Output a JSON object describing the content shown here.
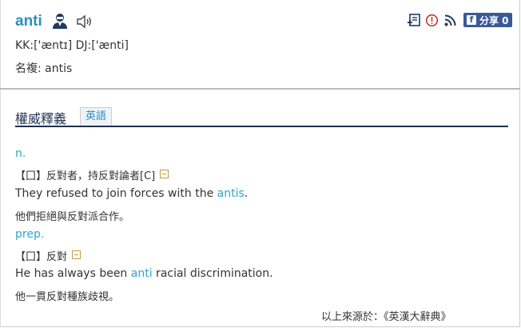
{
  "entry": {
    "word": "anti",
    "kk": "KK:['æntɪ] DJ:['ænti]",
    "plural": "名複: antis"
  },
  "toolbar": {
    "share_label": "分享 0",
    "fb_glyph": "f"
  },
  "tabs": {
    "section_title": "權威釋義",
    "english_tab": "英語"
  },
  "definitions": [
    {
      "pos": "n.",
      "sense": "【囗】反對者，持反對論者[C]",
      "example_before": "They refused to join forces with the ",
      "example_highlight": "antis",
      "example_after": ".",
      "translation": "他們拒絕與反對派合作。"
    },
    {
      "pos": "prep.",
      "sense": "【囗】反對",
      "example_before": "He has always been ",
      "example_highlight": "anti",
      "example_after": " racial discrimination.",
      "translation": "他一貫反對種族歧視。"
    }
  ],
  "source": "以上來源於：《英漢大辭典》",
  "colors": {
    "accent": "#2a8fbd",
    "pos": "#35a3c4",
    "tab_line": "#1e3050",
    "facebook": "#3b5998"
  }
}
